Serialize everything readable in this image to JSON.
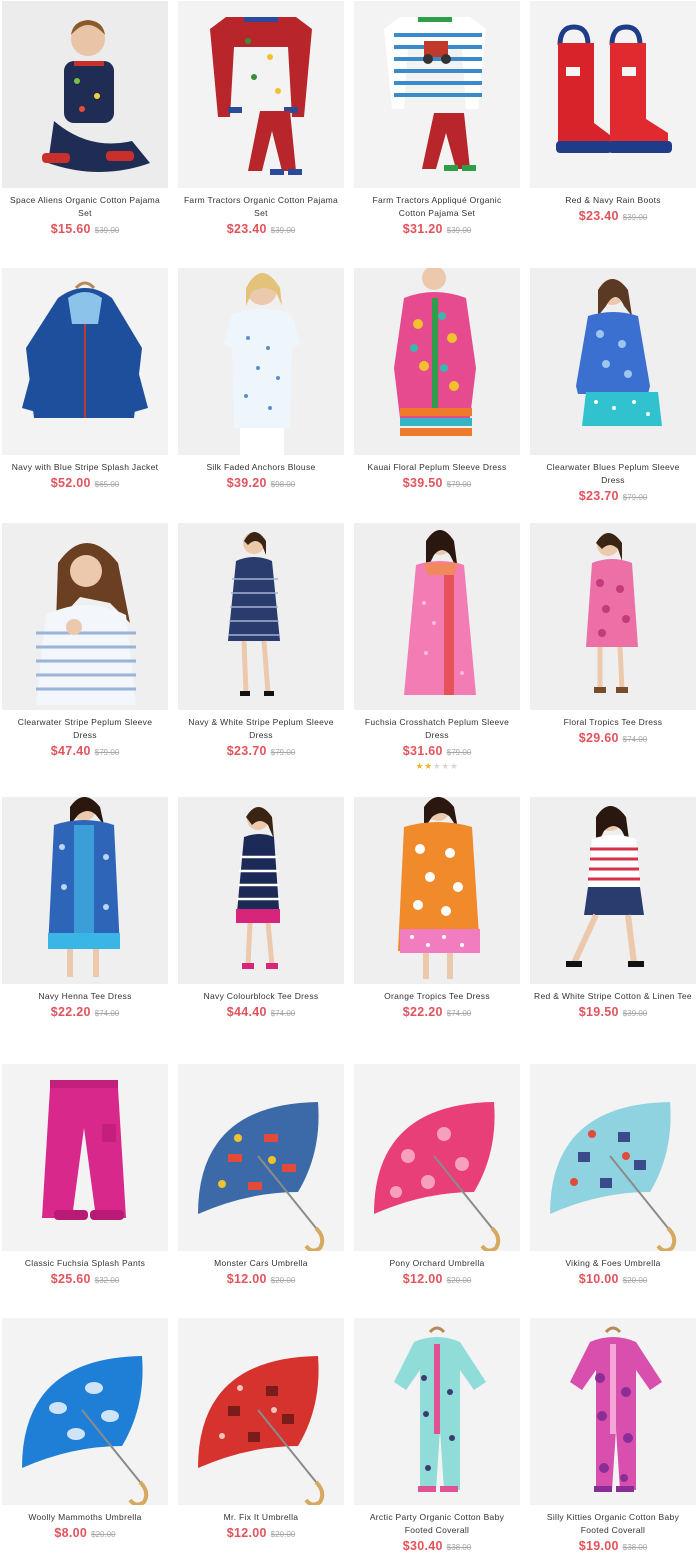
{
  "products": [
    {
      "name": "Space Aliens Organic Cotton Pajama Set",
      "sale_price": "$15.60",
      "orig_price": "$39.00",
      "image": "boy-pajama-photo"
    },
    {
      "name": "Farm Tractors Organic Cotton Pajama Set",
      "sale_price": "$23.40",
      "orig_price": "$39.00",
      "image": "red-pajama-set"
    },
    {
      "name": "Farm Tractors Appliqué Organic Cotton Pajama Set",
      "sale_price": "$31.20",
      "orig_price": "$39.00",
      "image": "striped-pajama-set"
    },
    {
      "name": "Red & Navy Rain Boots",
      "sale_price": "$23.40",
      "orig_price": "$39.00",
      "image": "rain-boots"
    },
    {
      "name": "Navy with Blue Stripe Splash Jacket",
      "sale_price": "$52.00",
      "orig_price": "$65.00",
      "image": "splash-jacket"
    },
    {
      "name": "Silk Faded Anchors Blouse",
      "sale_price": "$39.20",
      "orig_price": "$98.00",
      "image": "blouse-model"
    },
    {
      "name": "Kauai Floral Peplum Sleeve Dress",
      "sale_price": "$39.50",
      "orig_price": "$79.00",
      "image": "dress-model"
    },
    {
      "name": "Clearwater Blues Peplum Sleeve Dress",
      "sale_price": "$23.70",
      "orig_price": "$79.00",
      "image": "dress-model"
    },
    {
      "name": "Clearwater Stripe Peplum Sleeve Dress",
      "sale_price": "$47.40",
      "orig_price": "$79.00",
      "image": "dress-model"
    },
    {
      "name": "Navy & White Stripe Peplum Sleeve Dress",
      "sale_price": "$23.70",
      "orig_price": "$79.00",
      "image": "dress-model"
    },
    {
      "name": "Fuchsia Crosshatch Peplum Sleeve Dress",
      "sale_price": "$31.60",
      "orig_price": "$79.00",
      "image": "dress-model",
      "rating": 2
    },
    {
      "name": "Floral Tropics Tee Dress",
      "sale_price": "$29.60",
      "orig_price": "$74.00",
      "image": "dress-model"
    },
    {
      "name": "Navy Henna Tee Dress",
      "sale_price": "$22.20",
      "orig_price": "$74.00",
      "image": "dress-model"
    },
    {
      "name": "Navy Colourblock Tee Dress",
      "sale_price": "$44.40",
      "orig_price": "$74.00",
      "image": "dress-model"
    },
    {
      "name": "Orange Tropics Tee Dress",
      "sale_price": "$22.20",
      "orig_price": "$74.00",
      "image": "dress-model"
    },
    {
      "name": "Red & White Stripe Cotton & Linen Tee",
      "sale_price": "$19.50",
      "orig_price": "$39.00",
      "image": "tee-model"
    },
    {
      "name": "Classic Fuchsia Splash Pants",
      "sale_price": "$25.60",
      "orig_price": "$32.00",
      "image": "splash-pants"
    },
    {
      "name": "Monster Cars Umbrella",
      "sale_price": "$12.00",
      "orig_price": "$20.00",
      "image": "umbrella"
    },
    {
      "name": "Pony Orchard Umbrella",
      "sale_price": "$12.00",
      "orig_price": "$20.00",
      "image": "umbrella"
    },
    {
      "name": "Viking & Foes Umbrella",
      "sale_price": "$10.00",
      "orig_price": "$20.00",
      "image": "umbrella"
    },
    {
      "name": "Woolly Mammoths Umbrella",
      "sale_price": "$8.00",
      "orig_price": "$20.00",
      "image": "umbrella"
    },
    {
      "name": "Mr. Fix It Umbrella",
      "sale_price": "$12.00",
      "orig_price": "$20.00",
      "image": "umbrella"
    },
    {
      "name": "Arctic Party Organic Cotton Baby Footed Coverall",
      "sale_price": "$30.40",
      "orig_price": "$38.00",
      "image": "baby-coverall"
    },
    {
      "name": "Silly Kitties Organic Cotton Baby Footed Coverall",
      "sale_price": "$19.00",
      "orig_price": "$38.00",
      "image": "baby-coverall"
    }
  ],
  "colors": {
    "sale_price": "#e2545c",
    "original_price": "#a8a8a8",
    "product_name": "#333333",
    "image_background": "#f3f3f3",
    "rating_star": "#f0b429"
  }
}
